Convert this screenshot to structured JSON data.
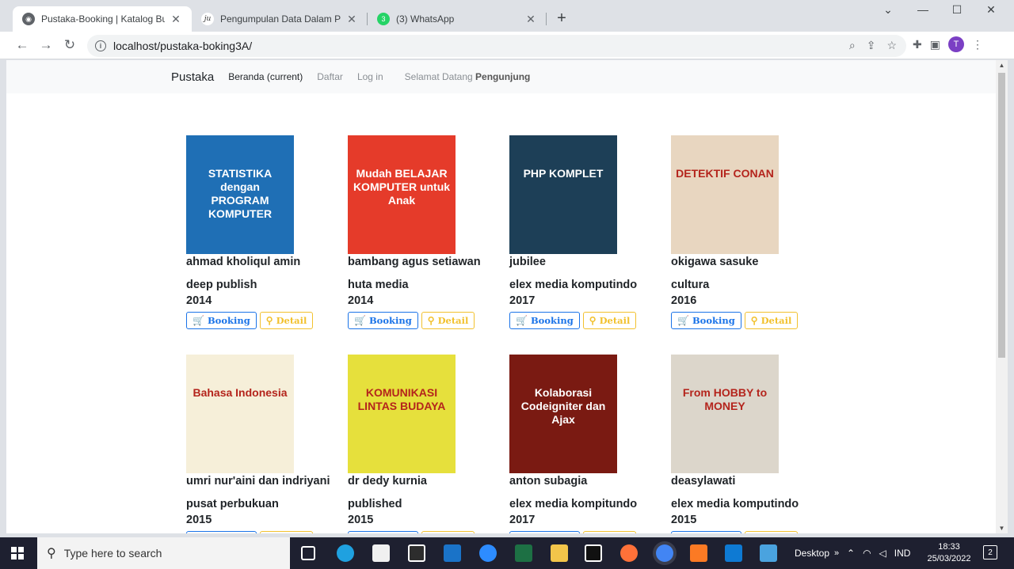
{
  "browser": {
    "tabs": [
      {
        "title": "Pustaka-Booking | Katalog Buku",
        "active": true
      },
      {
        "title": "Pengumpulan Data Dalam Penelit",
        "active": false
      },
      {
        "title": "(3) WhatsApp",
        "active": false,
        "badge": "3"
      }
    ],
    "new_tab": "+",
    "url": "localhost/pustaka-boking3A/"
  },
  "site_nav": {
    "brand": "Pustaka",
    "links": [
      "Beranda (current)",
      "Daftar",
      "Log in"
    ],
    "welcome_prefix": "Selamat Datang",
    "welcome_user": "Pengunjung"
  },
  "buttons": {
    "booking": "Booking",
    "detail": "Detail"
  },
  "books": [
    {
      "author": "ahmad kholiqul amin",
      "publisher": "deep publish",
      "year": "2014",
      "cover_title": "STATISTIKA dengan PROGRAM KOMPUTER",
      "cover_color": "#1f6fb5"
    },
    {
      "author": "bambang agus setiawan",
      "publisher": "huta media",
      "year": "2014",
      "cover_title": "Mudah BELAJAR KOMPUTER untuk Anak",
      "cover_color": "#e53b2a"
    },
    {
      "author": "jubilee",
      "publisher": "elex media komputindo",
      "year": "2017",
      "cover_title": "PHP KOMPLET",
      "cover_color": "#1d3f57"
    },
    {
      "author": "okigawa sasuke",
      "publisher": "cultura",
      "year": "2016",
      "cover_title": "DETEKTIF CONAN",
      "cover_color": "#e8d6c0"
    },
    {
      "author": "umri nur'aini dan indriyani",
      "publisher": "pusat perbukuan",
      "year": "2015",
      "cover_title": "Bahasa Indonesia",
      "cover_color": "#f6efd9"
    },
    {
      "author": "dr dedy kurnia",
      "publisher": "published",
      "year": "2015",
      "cover_title": "KOMUNIKASI LINTAS BUDAYA",
      "cover_color": "#e6e03c"
    },
    {
      "author": "anton subagia",
      "publisher": "elex media kompitundo",
      "year": "2017",
      "cover_title": "Kolaborasi Codeigniter dan Ajax",
      "cover_color": "#7a1a12"
    },
    {
      "author": "deasylawati",
      "publisher": "elex media komputindo",
      "year": "2015",
      "cover_title": "From HOBBY to MONEY",
      "cover_color": "#dcd6cb"
    }
  ],
  "taskbar": {
    "search_placeholder": "Type here to search",
    "desktop_label": "Desktop",
    "language": "IND",
    "time": "18:33",
    "date": "25/03/2022",
    "notifications": "2"
  }
}
